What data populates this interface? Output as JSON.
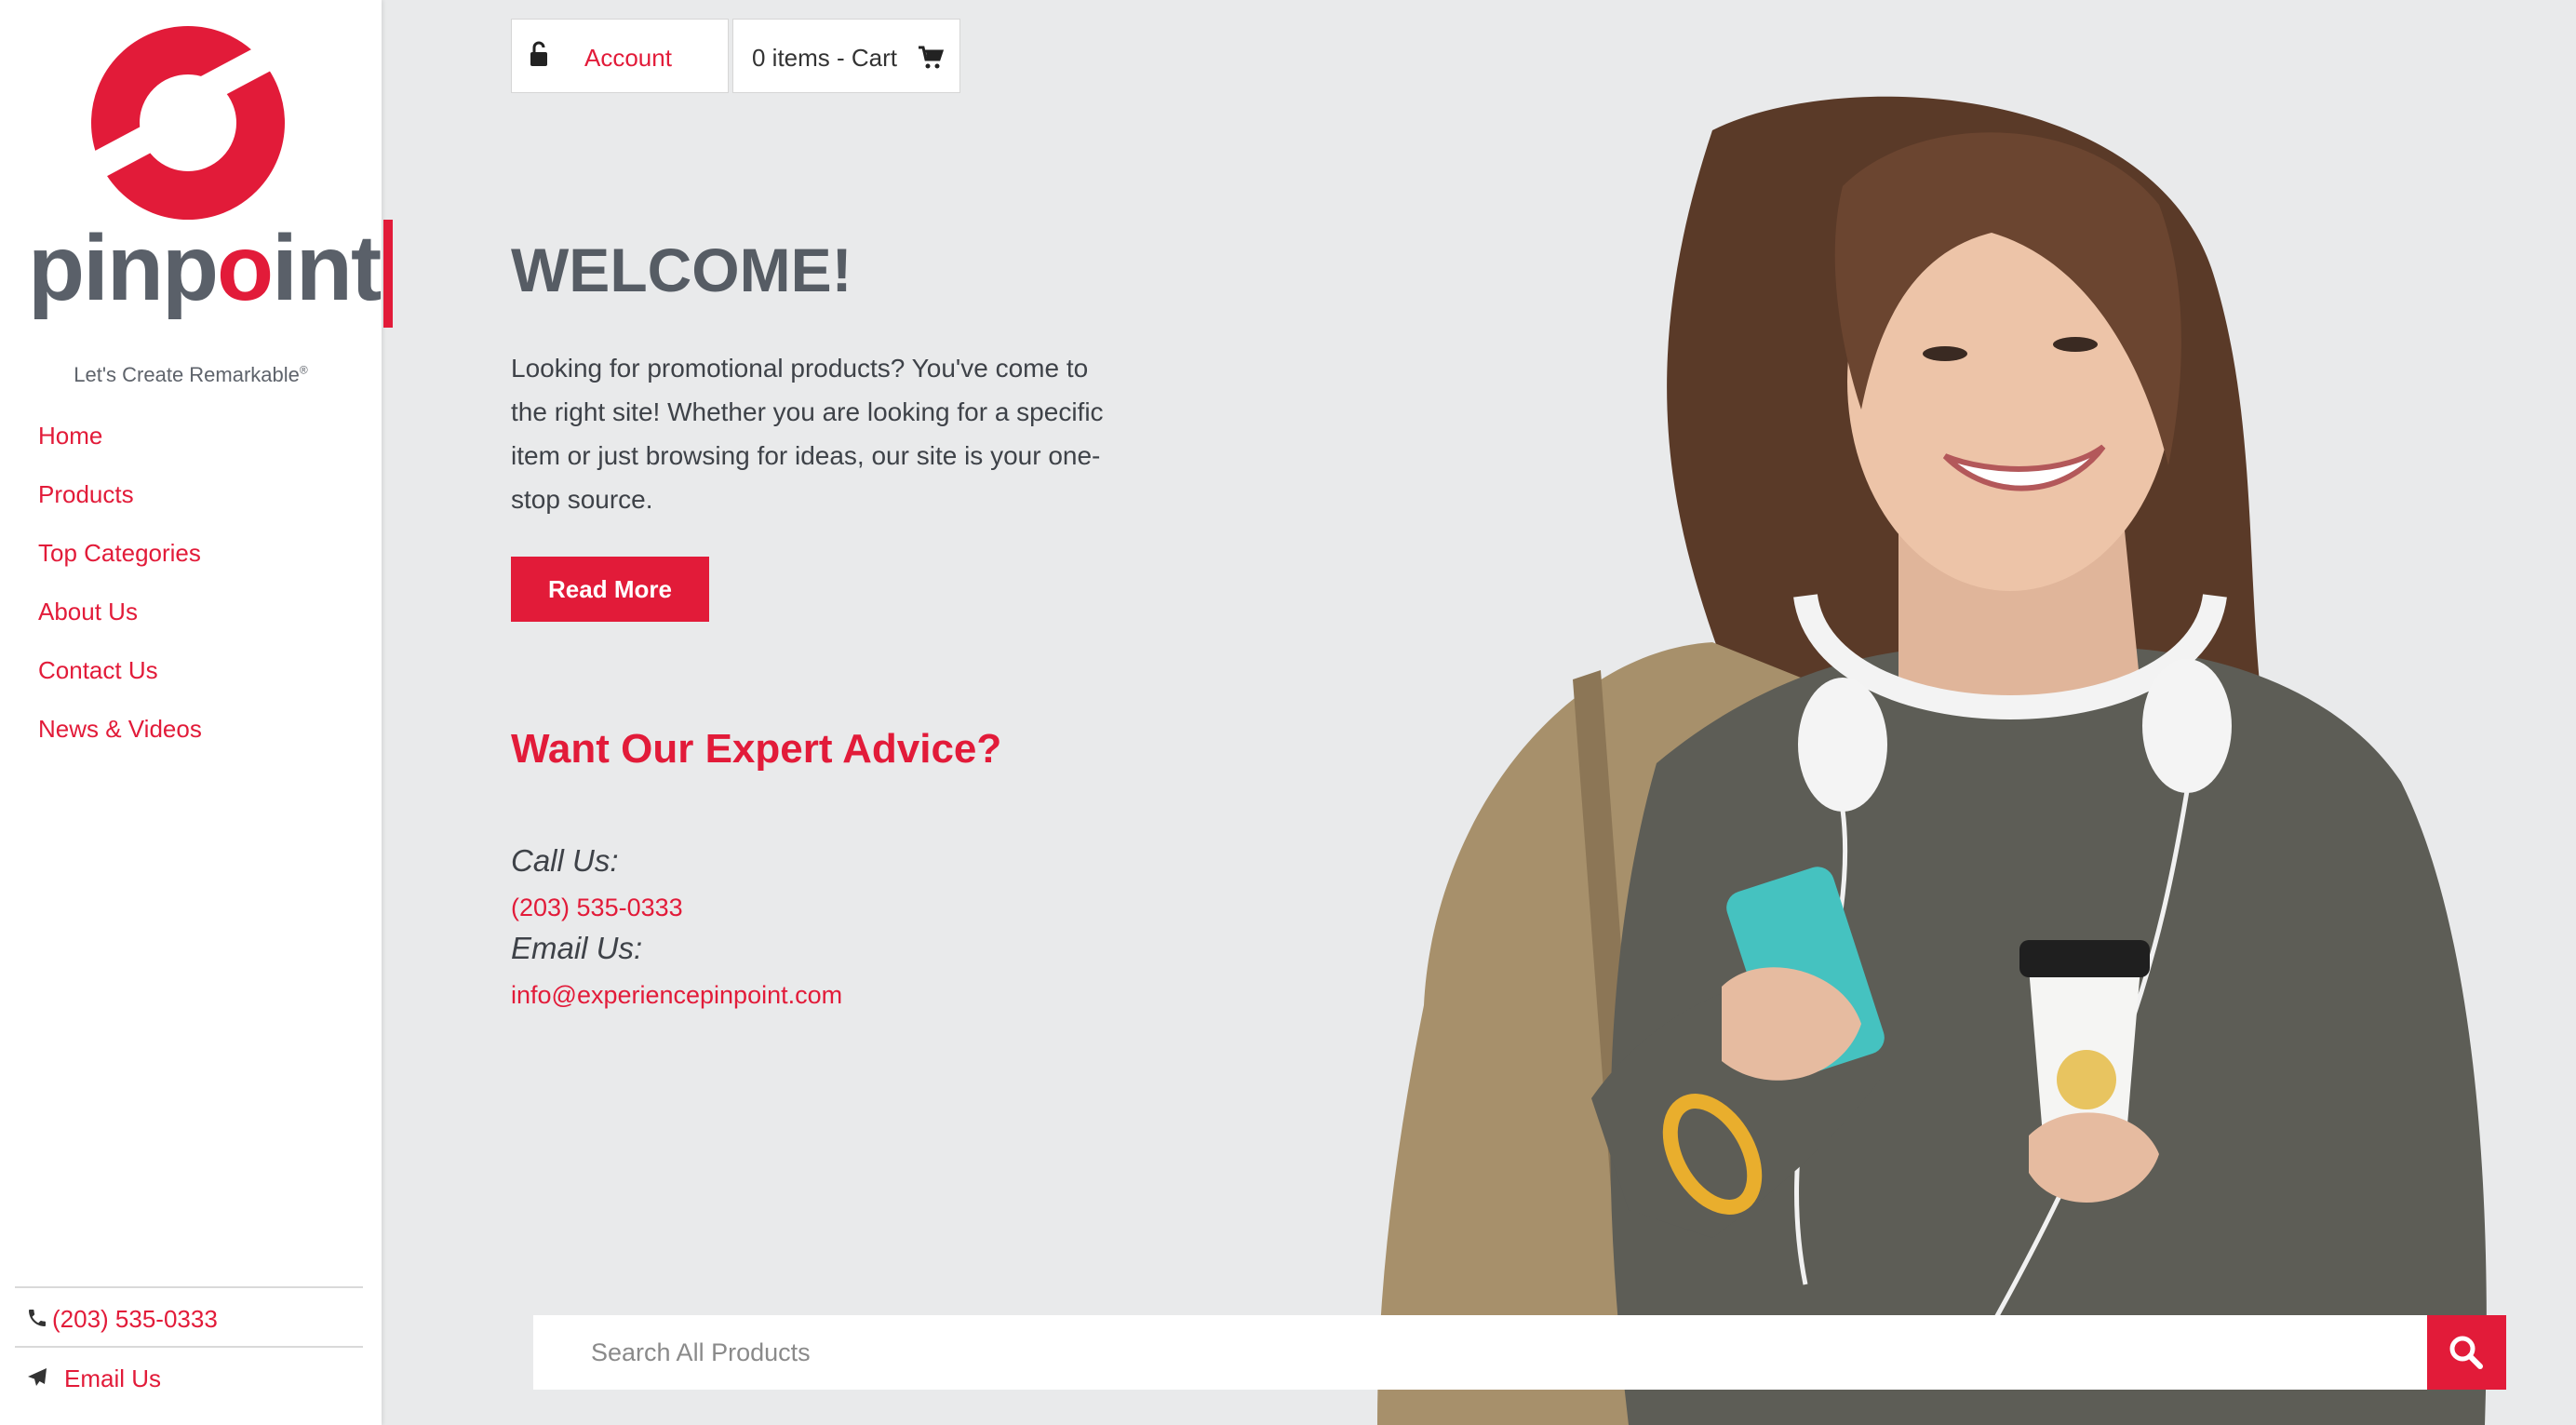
{
  "brand": {
    "name_parts": [
      "pinp",
      "o",
      "int"
    ],
    "tagline": "Let's Create Remarkable",
    "tagline_mark": "®",
    "accent_color": "#e21b39",
    "gray_color": "#5a6069"
  },
  "nav": {
    "items": [
      {
        "label": "Home"
      },
      {
        "label": "Products"
      },
      {
        "label": "Top Categories"
      },
      {
        "label": "About Us"
      },
      {
        "label": "Contact Us"
      },
      {
        "label": "News & Videos"
      }
    ]
  },
  "sidebar_contact": {
    "phone": "(203) 535-0333",
    "phone_icon": "phone-icon",
    "email_label": "Email Us",
    "email_icon": "paper-plane-icon"
  },
  "topbar": {
    "account_label": "Account",
    "account_icon": "unlock-icon",
    "cart_label": "0 items - Cart",
    "cart_icon": "cart-icon"
  },
  "main": {
    "welcome_title": "WELCOME!",
    "intro_text": "Looking for promotional products? You've come to the right site! Whether you are looking for a specific item or just browsing for ideas, our site is your one-stop source.",
    "read_more_label": "Read More",
    "advice_heading": "Want Our Expert Advice?",
    "call_label": "Call Us:",
    "call_value": "(203) 535-0333",
    "email_label": "Email Us:",
    "email_value": "info@experiencepinpoint.com"
  },
  "search": {
    "placeholder": "Search All Products",
    "value": "",
    "icon": "search-icon"
  }
}
